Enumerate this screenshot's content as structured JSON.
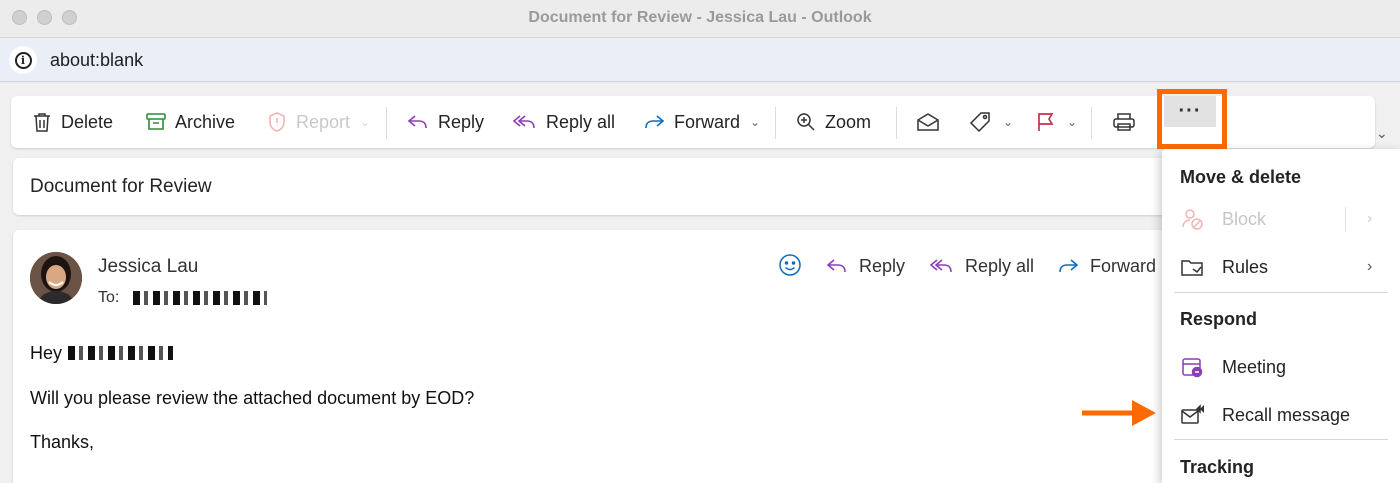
{
  "window": {
    "title": "Document for Review - Jessica Lau - Outlook"
  },
  "address_bar": {
    "url": "about:blank",
    "info_icon": "info-icon"
  },
  "toolbar": {
    "delete": "Delete",
    "archive": "Archive",
    "report": "Report",
    "reply": "Reply",
    "reply_all": "Reply all",
    "forward": "Forward",
    "zoom": "Zoom",
    "more": "···"
  },
  "message": {
    "subject": "Document for Review",
    "sender": "Jessica Lau",
    "to_label": "To:",
    "actions": {
      "reply": "Reply",
      "reply_all": "Reply all",
      "forward": "Forward"
    },
    "body": {
      "greeting": "Hey",
      "line1": "Will you please review the attached document by EOD?",
      "closing": "Thanks,"
    }
  },
  "menu": {
    "section_move": "Move & delete",
    "block": "Block",
    "rules": "Rules",
    "section_respond": "Respond",
    "meeting": "Meeting",
    "recall": "Recall message",
    "section_tracking": "Tracking"
  },
  "colors": {
    "accent_blue": "#0f6cbd",
    "reply_purple": "#8a3fb6",
    "archive_green": "#2f8a3c",
    "flag_red": "#c4314b",
    "highlight_orange": "#ff6a00"
  }
}
